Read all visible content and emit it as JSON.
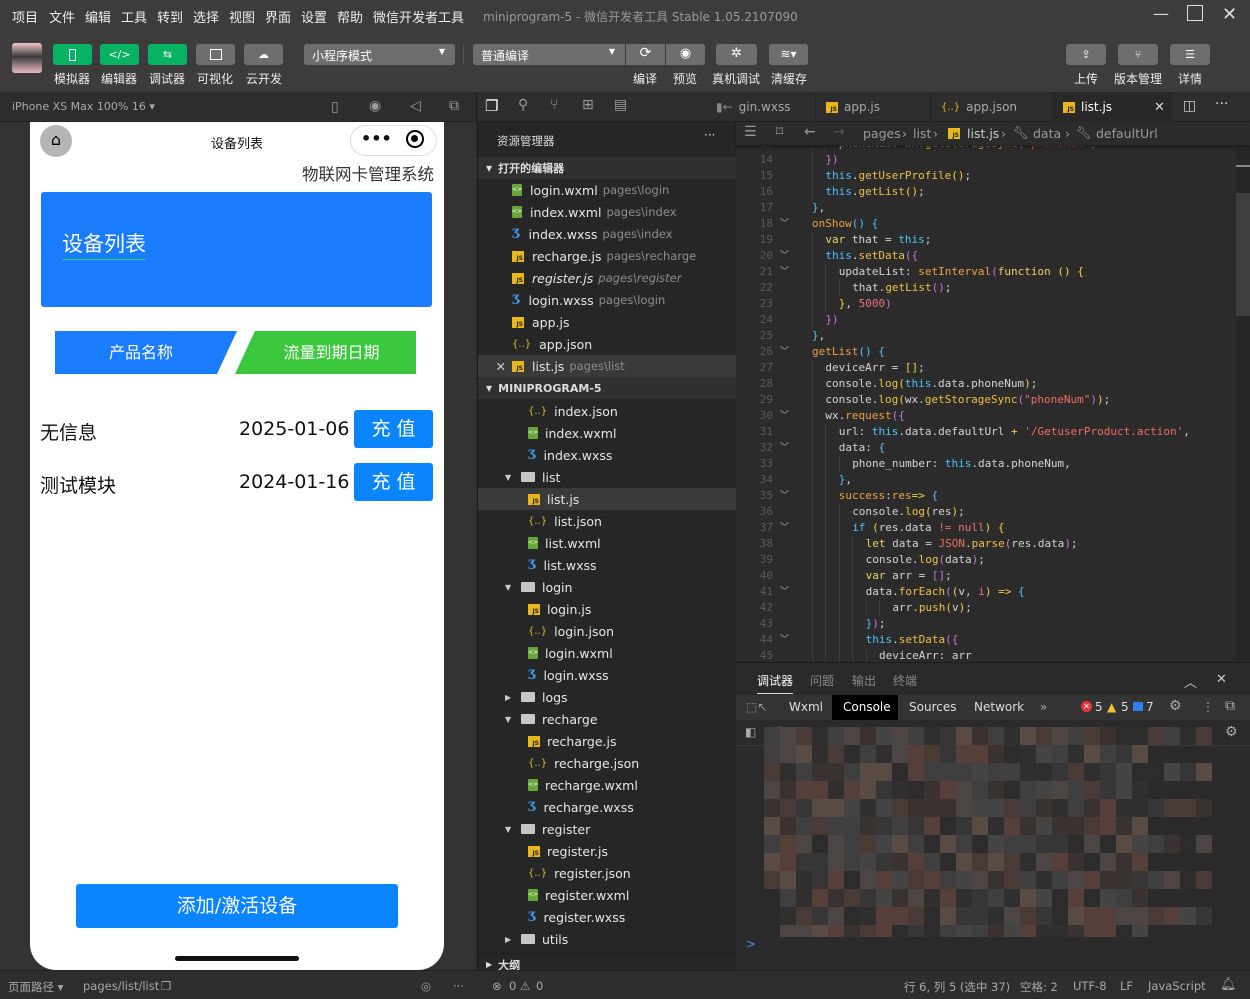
{
  "menubar": {
    "items": [
      "项目",
      "文件",
      "编辑",
      "工具",
      "转到",
      "选择",
      "视图",
      "界面",
      "设置",
      "帮助",
      "微信开发者工具"
    ],
    "title": "miniprogram-5 - 微信开发者工具 Stable 1.05.2107090"
  },
  "toolbar": {
    "left": [
      {
        "label": "模拟器",
        "icon": "phone-icon",
        "active": true
      },
      {
        "label": "编辑器",
        "icon": "code-icon",
        "active": true
      },
      {
        "label": "调试器",
        "icon": "debug-arrows-icon",
        "active": true
      },
      {
        "label": "可视化",
        "icon": "layout-icon",
        "active": false
      },
      {
        "label": "云开发",
        "icon": "cloud-icon",
        "active": false
      }
    ],
    "mode": "小程序模式",
    "compile_mode": "普通编译",
    "compile": "编译",
    "preview": "预览",
    "remote_debug": "真机调试",
    "clear_cache": "清缓存",
    "upload": "上传",
    "version": "版本管理",
    "details": "详情"
  },
  "simulator": {
    "device": "iPhone XS Max 100% 16 ▾"
  },
  "phone": {
    "nav_title": "设备列表",
    "system_title": "物联网卡管理系统",
    "banner_title": "设备列表",
    "tab_product": "产品名称",
    "tab_expiry": "流量到期日期",
    "rows": [
      {
        "name": "无信息",
        "date": "2025-01-06",
        "action": "充 值"
      },
      {
        "name": "测试模块",
        "date": "2024-01-16",
        "action": "充 值"
      }
    ],
    "add_button": "添加/激活设备",
    "colors": {
      "primary": "#1a7cff",
      "green": "#3cc83c"
    }
  },
  "editor_tabs": [
    {
      "name": "gin.wxss",
      "icon": "wxss"
    },
    {
      "name": "app.js",
      "icon": "js"
    },
    {
      "name": "app.json",
      "icon": "json"
    },
    {
      "name": "list.js",
      "icon": "js",
      "active": true
    }
  ],
  "explorer": {
    "title": "资源管理器",
    "open_section": "打开的编辑器",
    "project_section": "MINIPROGRAM-5",
    "outline": "大纲",
    "open": [
      {
        "icon": "wxml",
        "name": "login.wxml",
        "path": "pages\\login"
      },
      {
        "icon": "wxml",
        "name": "index.wxml",
        "path": "pages\\index"
      },
      {
        "icon": "wxss",
        "name": "index.wxss",
        "path": "pages\\index"
      },
      {
        "icon": "js",
        "name": "recharge.js",
        "path": "pages\\recharge"
      },
      {
        "icon": "js",
        "name": "register.js",
        "path": "pages\\register",
        "italic": true
      },
      {
        "icon": "wxss",
        "name": "login.wxss",
        "path": "pages\\login"
      },
      {
        "icon": "js",
        "name": "app.js",
        "path": ""
      },
      {
        "icon": "json",
        "name": "app.json",
        "path": ""
      },
      {
        "icon": "js",
        "name": "list.js",
        "path": "pages\\list",
        "active": true
      }
    ],
    "tree": [
      {
        "icon": "json",
        "name": "index.json"
      },
      {
        "icon": "wxml",
        "name": "index.wxml"
      },
      {
        "icon": "wxss",
        "name": "index.wxss"
      },
      {
        "icon": "folder",
        "name": "list",
        "expanded": true
      },
      {
        "icon": "js",
        "name": "list.js",
        "selected": true
      },
      {
        "icon": "json",
        "name": "list.json"
      },
      {
        "icon": "wxml",
        "name": "list.wxml"
      },
      {
        "icon": "wxss",
        "name": "list.wxss"
      },
      {
        "icon": "folder",
        "name": "login",
        "expanded": true
      },
      {
        "icon": "js",
        "name": "login.js"
      },
      {
        "icon": "json",
        "name": "login.json"
      },
      {
        "icon": "wxml",
        "name": "login.wxml"
      },
      {
        "icon": "wxss",
        "name": "login.wxss"
      },
      {
        "icon": "folder",
        "name": "logs",
        "expanded": false
      },
      {
        "icon": "folder",
        "name": "recharge",
        "expanded": true
      },
      {
        "icon": "js",
        "name": "recharge.js"
      },
      {
        "icon": "json",
        "name": "recharge.json"
      },
      {
        "icon": "wxml",
        "name": "recharge.wxml"
      },
      {
        "icon": "wxss",
        "name": "recharge.wxss"
      },
      {
        "icon": "folder",
        "name": "register",
        "expanded": true
      },
      {
        "icon": "js",
        "name": "register.js"
      },
      {
        "icon": "json",
        "name": "register.json"
      },
      {
        "icon": "wxml",
        "name": "register.wxml"
      },
      {
        "icon": "wxss",
        "name": "register.wxss"
      },
      {
        "icon": "folder",
        "name": "utils",
        "expanded": false
      }
    ]
  },
  "breadcrumb": [
    "pages",
    "list",
    "list.js",
    "data",
    "defaultUrl"
  ],
  "code": [
    {
      "n": 13,
      "i": 2,
      "t": [
        [
          "p",
          "phoneNum: wx."
        ],
        [
          "f",
          "getStorageSync"
        ],
        [
          "b",
          "("
        ],
        [
          "s",
          "'phoneNum'"
        ],
        [
          "b",
          ")"
        ]
      ]
    },
    {
      "n": 14,
      "i": 1,
      "t": [
        [
          "b",
          "})"
        ]
      ]
    },
    {
      "n": 15,
      "i": 1,
      "t": [
        [
          "k",
          "this"
        ],
        [
          "p",
          "."
        ],
        [
          "f",
          "getUserProfile"
        ],
        [
          "y",
          "()"
        ],
        [
          "p",
          ";"
        ]
      ]
    },
    {
      "n": 16,
      "i": 1,
      "t": [
        [
          "k",
          "this"
        ],
        [
          "p",
          "."
        ],
        [
          "f",
          "getList"
        ],
        [
          "y",
          "()"
        ],
        [
          "p",
          ";"
        ]
      ]
    },
    {
      "n": 17,
      "i": 0,
      "t": [
        [
          "k",
          "}"
        ],
        [
          "p",
          ","
        ]
      ]
    },
    {
      "n": 18,
      "i": 0,
      "f": 1,
      "t": [
        [
          "o",
          "onShow"
        ],
        [
          "k",
          "()"
        ],
        [
          "p",
          " "
        ],
        [
          "k",
          "{"
        ]
      ]
    },
    {
      "n": 19,
      "i": 1,
      "t": [
        [
          "v",
          "var"
        ],
        [
          "p",
          " that = "
        ],
        [
          "k",
          "this"
        ],
        [
          "p",
          ";"
        ]
      ]
    },
    {
      "n": 20,
      "i": 1,
      "f": 1,
      "t": [
        [
          "k",
          "this"
        ],
        [
          "p",
          "."
        ],
        [
          "f",
          "setData"
        ],
        [
          "b",
          "({"
        ]
      ]
    },
    {
      "n": 21,
      "i": 2,
      "f": 1,
      "t": [
        [
          "p",
          "updateList: "
        ],
        [
          "o",
          "setInterval"
        ],
        [
          "b",
          "("
        ],
        [
          "v",
          "function"
        ],
        [
          "p",
          " "
        ],
        [
          "y",
          "()"
        ],
        [
          "p",
          " "
        ],
        [
          "y",
          "{"
        ]
      ]
    },
    {
      "n": 22,
      "i": 3,
      "t": [
        [
          "p",
          "that."
        ],
        [
          "f",
          "getList"
        ],
        [
          "b",
          "()"
        ],
        [
          "p",
          ";"
        ]
      ]
    },
    {
      "n": 23,
      "i": 2,
      "t": [
        [
          "y",
          "}"
        ],
        [
          "p",
          ", "
        ],
        [
          "n",
          "5000"
        ],
        [
          "b",
          ")"
        ]
      ]
    },
    {
      "n": 24,
      "i": 1,
      "t": [
        [
          "b",
          "})"
        ]
      ]
    },
    {
      "n": 25,
      "i": 0,
      "t": [
        [
          "k",
          "}"
        ],
        [
          "p",
          ","
        ]
      ]
    },
    {
      "n": 26,
      "i": 0,
      "f": 1,
      "t": [
        [
          "o",
          "getList"
        ],
        [
          "k",
          "()"
        ],
        [
          "p",
          " "
        ],
        [
          "k",
          "{"
        ]
      ]
    },
    {
      "n": 27,
      "i": 1,
      "t": [
        [
          "p",
          "deviceArr = "
        ],
        [
          "y",
          "[]"
        ],
        [
          "p",
          ";"
        ]
      ]
    },
    {
      "n": 28,
      "i": 1,
      "t": [
        [
          "p",
          "console."
        ],
        [
          "f",
          "log"
        ],
        [
          "y",
          "("
        ],
        [
          "k",
          "this"
        ],
        [
          "p",
          ".data.phoneNum"
        ],
        [
          "y",
          ")"
        ],
        [
          "p",
          ";"
        ]
      ]
    },
    {
      "n": 29,
      "i": 1,
      "t": [
        [
          "p",
          "console."
        ],
        [
          "f",
          "log"
        ],
        [
          "y",
          "("
        ],
        [
          "p",
          "wx."
        ],
        [
          "f",
          "getStorageSync"
        ],
        [
          "b",
          "("
        ],
        [
          "s",
          "\"phoneNum\""
        ],
        [
          "b",
          ")"
        ],
        [
          "y",
          ")"
        ],
        [
          "p",
          ";"
        ]
      ]
    },
    {
      "n": 30,
      "i": 1,
      "f": 1,
      "t": [
        [
          "p",
          "wx."
        ],
        [
          "o",
          "request"
        ],
        [
          "b",
          "({"
        ]
      ]
    },
    {
      "n": 31,
      "i": 2,
      "t": [
        [
          "p",
          "url: "
        ],
        [
          "k",
          "this"
        ],
        [
          "p",
          ".data.defaultUrl "
        ],
        [
          "y",
          "+"
        ],
        [
          "p",
          " "
        ],
        [
          "s",
          "'/GetuserProduct.action'"
        ],
        [
          "p",
          ","
        ]
      ]
    },
    {
      "n": 32,
      "i": 2,
      "f": 1,
      "t": [
        [
          "p",
          "data: "
        ],
        [
          "k",
          "{"
        ]
      ]
    },
    {
      "n": 33,
      "i": 3,
      "t": [
        [
          "p",
          "phone_number: "
        ],
        [
          "k",
          "this"
        ],
        [
          "p",
          ".data.phoneNum,"
        ]
      ]
    },
    {
      "n": 34,
      "i": 2,
      "t": [
        [
          "k",
          "}"
        ],
        [
          "p",
          ","
        ]
      ]
    },
    {
      "n": 35,
      "i": 2,
      "f": 1,
      "t": [
        [
          "o",
          "success"
        ],
        [
          "p",
          ":"
        ],
        [
          "o",
          "res"
        ],
        [
          "y",
          "=>"
        ],
        [
          "p",
          " "
        ],
        [
          "k",
          "{"
        ]
      ]
    },
    {
      "n": 36,
      "i": 3,
      "t": [
        [
          "p",
          "console."
        ],
        [
          "f",
          "log"
        ],
        [
          "y",
          "("
        ],
        [
          "p",
          "res"
        ],
        [
          "y",
          ")"
        ],
        [
          "p",
          ";"
        ]
      ]
    },
    {
      "n": 37,
      "i": 3,
      "f": 1,
      "t": [
        [
          "k",
          "if"
        ],
        [
          "p",
          " "
        ],
        [
          "y",
          "("
        ],
        [
          "p",
          "res.data "
        ],
        [
          "s",
          "!="
        ],
        [
          "p",
          " "
        ],
        [
          "n",
          "null"
        ],
        [
          "y",
          ")"
        ],
        [
          "p",
          " "
        ],
        [
          "y",
          "{"
        ]
      ]
    },
    {
      "n": 38,
      "i": 4,
      "t": [
        [
          "v",
          "let"
        ],
        [
          "p",
          " data = "
        ],
        [
          "s",
          "JSON"
        ],
        [
          "p",
          "."
        ],
        [
          "f",
          "parse"
        ],
        [
          "b",
          "("
        ],
        [
          "p",
          "res.data"
        ],
        [
          "b",
          ")"
        ],
        [
          "p",
          ";"
        ]
      ]
    },
    {
      "n": 39,
      "i": 4,
      "t": [
        [
          "p",
          "console."
        ],
        [
          "f",
          "log"
        ],
        [
          "b",
          "("
        ],
        [
          "p",
          "data"
        ],
        [
          "b",
          ")"
        ],
        [
          "p",
          ";"
        ]
      ]
    },
    {
      "n": 40,
      "i": 4,
      "t": [
        [
          "v",
          "var"
        ],
        [
          "p",
          " arr = "
        ],
        [
          "b",
          "[]"
        ],
        [
          "p",
          ";"
        ]
      ]
    },
    {
      "n": 41,
      "i": 4,
      "f": 1,
      "t": [
        [
          "p",
          "data."
        ],
        [
          "f",
          "forEach"
        ],
        [
          "b",
          "("
        ],
        [
          "y",
          "("
        ],
        [
          "p",
          "v, "
        ],
        [
          "n",
          "i"
        ],
        [
          "y",
          ")"
        ],
        [
          "p",
          " "
        ],
        [
          "y",
          "=>"
        ],
        [
          "p",
          " "
        ],
        [
          "k",
          "{"
        ]
      ]
    },
    {
      "n": 42,
      "i": 6,
      "t": [
        [
          "p",
          "arr."
        ],
        [
          "f",
          "push"
        ],
        [
          "y",
          "("
        ],
        [
          "p",
          "v"
        ],
        [
          "y",
          ")"
        ],
        [
          "p",
          ";"
        ]
      ]
    },
    {
      "n": 43,
      "i": 4,
      "t": [
        [
          "k",
          "}"
        ],
        [
          "b",
          ")"
        ],
        [
          "p",
          ";"
        ]
      ]
    },
    {
      "n": 44,
      "i": 4,
      "f": 1,
      "t": [
        [
          "k",
          "this"
        ],
        [
          "p",
          "."
        ],
        [
          "f",
          "setData"
        ],
        [
          "b",
          "({"
        ]
      ]
    },
    {
      "n": 45,
      "i": 5,
      "t": [
        [
          "p",
          "deviceArr: arr"
        ]
      ]
    }
  ],
  "debugger": {
    "tabs": [
      "调试器",
      "问题",
      "输出",
      "终端"
    ],
    "devtools_tabs": [
      "Wxml",
      "Console",
      "Sources",
      "Network"
    ],
    "active_devtool": "Console",
    "errors": "5",
    "warnings": "5",
    "infos": "7",
    "prompt": ">"
  },
  "statusbar": {
    "page_path_label": "页面路径 ▾",
    "page_path": "pages/list/list",
    "errors": "0",
    "warnings": "0",
    "cursor": "行 6, 列 5 (选中 37)",
    "spaces": "空格: 2",
    "encoding": "UTF-8",
    "eol": "LF",
    "language": "JavaScript"
  }
}
